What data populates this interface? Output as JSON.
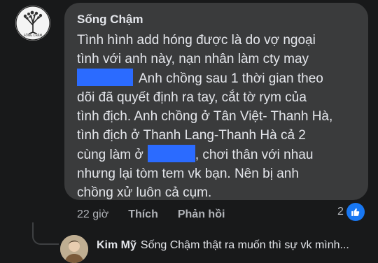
{
  "comment": {
    "author": "Sống Chậm",
    "avatar_label": "SỐNG CHẬM",
    "lines": [
      "Tình hình add hóng được là do vợ ngoại",
      "tình với anh này, nạn nhân làm cty may",
      "Anh chồng sau 1 thời gian theo",
      "dõi đã quyết định ra tay, cắt tờ rym của",
      "tình địch. Anh chồng ở Tân Việt- Thanh Hà,",
      "tình địch ở Thanh Lang-Thanh Hà cả 2",
      "cùng làm ở",
      ", chơi thân với nhau",
      "nhưng lại tòm tem vk bạn. Nên bị anh",
      "chồng xử luôn cả cụm."
    ],
    "time": "22 giờ",
    "like_label": "Thích",
    "reply_label": "Phản hồi",
    "reaction_count": "2",
    "reaction_icon": "thumbs-up-icon"
  },
  "reply": {
    "author": "Kim Mỹ",
    "text": "Sống Chậm thật ra muốn thì sự vk mình..."
  },
  "colors": {
    "background": "#18191a",
    "bubble": "#3a3b3c",
    "redaction": "#2b6bff",
    "like_blue": "#1877f2"
  }
}
